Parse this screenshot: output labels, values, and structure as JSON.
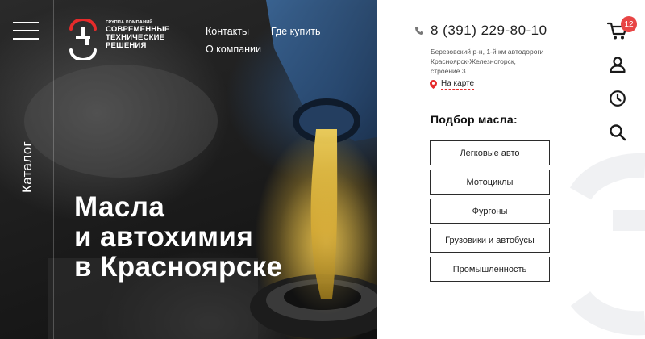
{
  "menu": {
    "icon": "hamburger-menu-icon"
  },
  "catalog": {
    "label": "Каталог"
  },
  "logo": {
    "small": "ГРУППА КОМПАНИЙ",
    "line1": "СОВРЕМЕННЫЕ",
    "line2": "ТЕХНИЧЕСКИЕ",
    "line3": "РЕШЕНИЯ",
    "accent_color": "#e52b2b"
  },
  "nav": {
    "contacts": "Контакты",
    "where_to_buy": "Где купить",
    "about": "О компании"
  },
  "hero": {
    "line1": "Масла",
    "line2": "и автохимия",
    "line3": "в Красноярске"
  },
  "contact": {
    "phone": "8 (391) 229-80-10",
    "address_line1": "Березовский р-н, 1-й км автодороги",
    "address_line2": "Красноярск-Железногорск,",
    "address_line3": "строение 3",
    "map_link": "На карте"
  },
  "oil_selection": {
    "title": "Подбор масла:",
    "buttons": [
      {
        "label": "Легковые авто"
      },
      {
        "label": "Мотоциклы"
      },
      {
        "label": "Фургоны"
      },
      {
        "label": "Грузовики и автобусы"
      },
      {
        "label": "Промышленность"
      }
    ]
  },
  "side_icons": {
    "cart_count": "12",
    "cart": "cart-icon",
    "user": "user-icon",
    "clock": "clock-icon",
    "search": "search-icon"
  },
  "colors": {
    "accent": "#e52b2b",
    "badge": "#e84545",
    "text_dark": "#1f1f1f"
  }
}
